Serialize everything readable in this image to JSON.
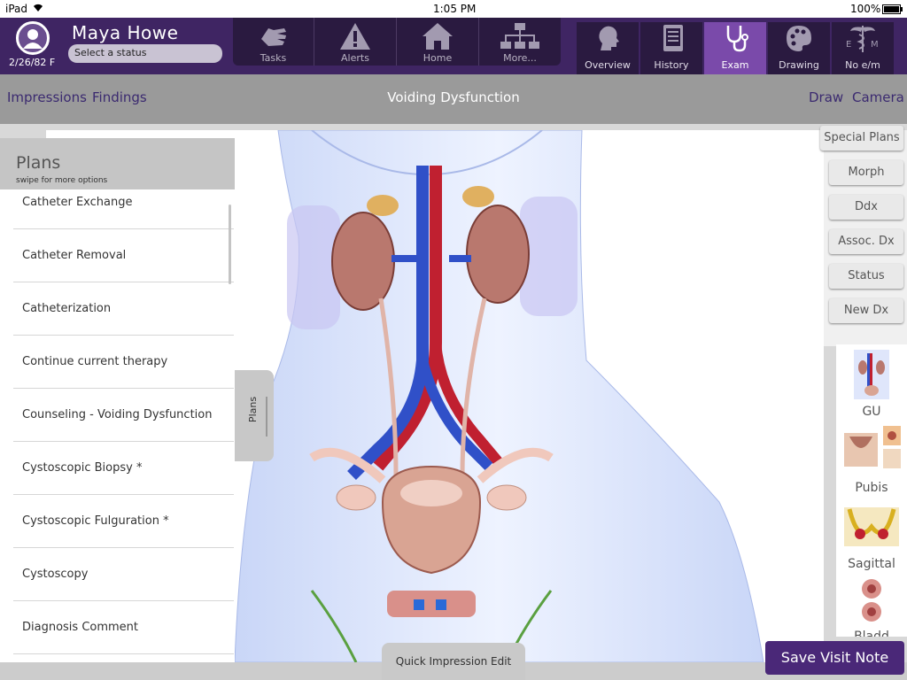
{
  "status_bar": {
    "device": "iPad",
    "time": "1:05 PM",
    "battery": "100%"
  },
  "patient": {
    "name": "Maya  Howe",
    "dob_sex": "2/26/82 F",
    "status_placeholder": "Select a status"
  },
  "nav_left": [
    {
      "label": "Tasks",
      "icon": "hand-icon"
    },
    {
      "label": "Alerts",
      "icon": "warning-icon"
    },
    {
      "label": "Home",
      "icon": "home-icon"
    },
    {
      "label": "More...",
      "icon": "hierarchy-icon"
    }
  ],
  "nav_right": [
    {
      "label": "Overview",
      "icon": "head-icon"
    },
    {
      "label": "History",
      "icon": "tablet-icon"
    },
    {
      "label": "Exam",
      "icon": "stethoscope-icon",
      "active": true
    },
    {
      "label": "Drawing",
      "icon": "palette-icon"
    },
    {
      "label": "No e/m",
      "icon": "em-caduceus-icon"
    }
  ],
  "subbar": {
    "impressions": "Impressions",
    "findings": "Findings",
    "title": "Voiding Dysfunction",
    "draw": "Draw",
    "camera": "Camera"
  },
  "plans": {
    "header": "Plans",
    "subheader": "swipe for more options",
    "tab_label": "Plans",
    "items": [
      "Catheter Exchange",
      "Catheter Removal",
      "Catheterization",
      "Continue current therapy",
      "Counseling - Voiding Dysfunction",
      "Cystoscopic Biopsy *",
      "Cystoscopic Fulguration *",
      "Cystoscopy",
      "Diagnosis Comment"
    ]
  },
  "right_buttons": [
    "Special Plans",
    "Morph",
    "Ddx",
    "Assoc. Dx",
    "Status",
    "New Dx"
  ],
  "thumbnails": [
    "GU",
    "Pubis",
    "Sagittal",
    "Bladd"
  ],
  "bottom": {
    "quick_impression": "Quick Impression Edit",
    "save": "Save Visit Note"
  },
  "colors": {
    "topbar": "#3f2563",
    "active_tab": "#7a4aaa",
    "save_button": "#4a2878",
    "link": "#3b2a70"
  }
}
